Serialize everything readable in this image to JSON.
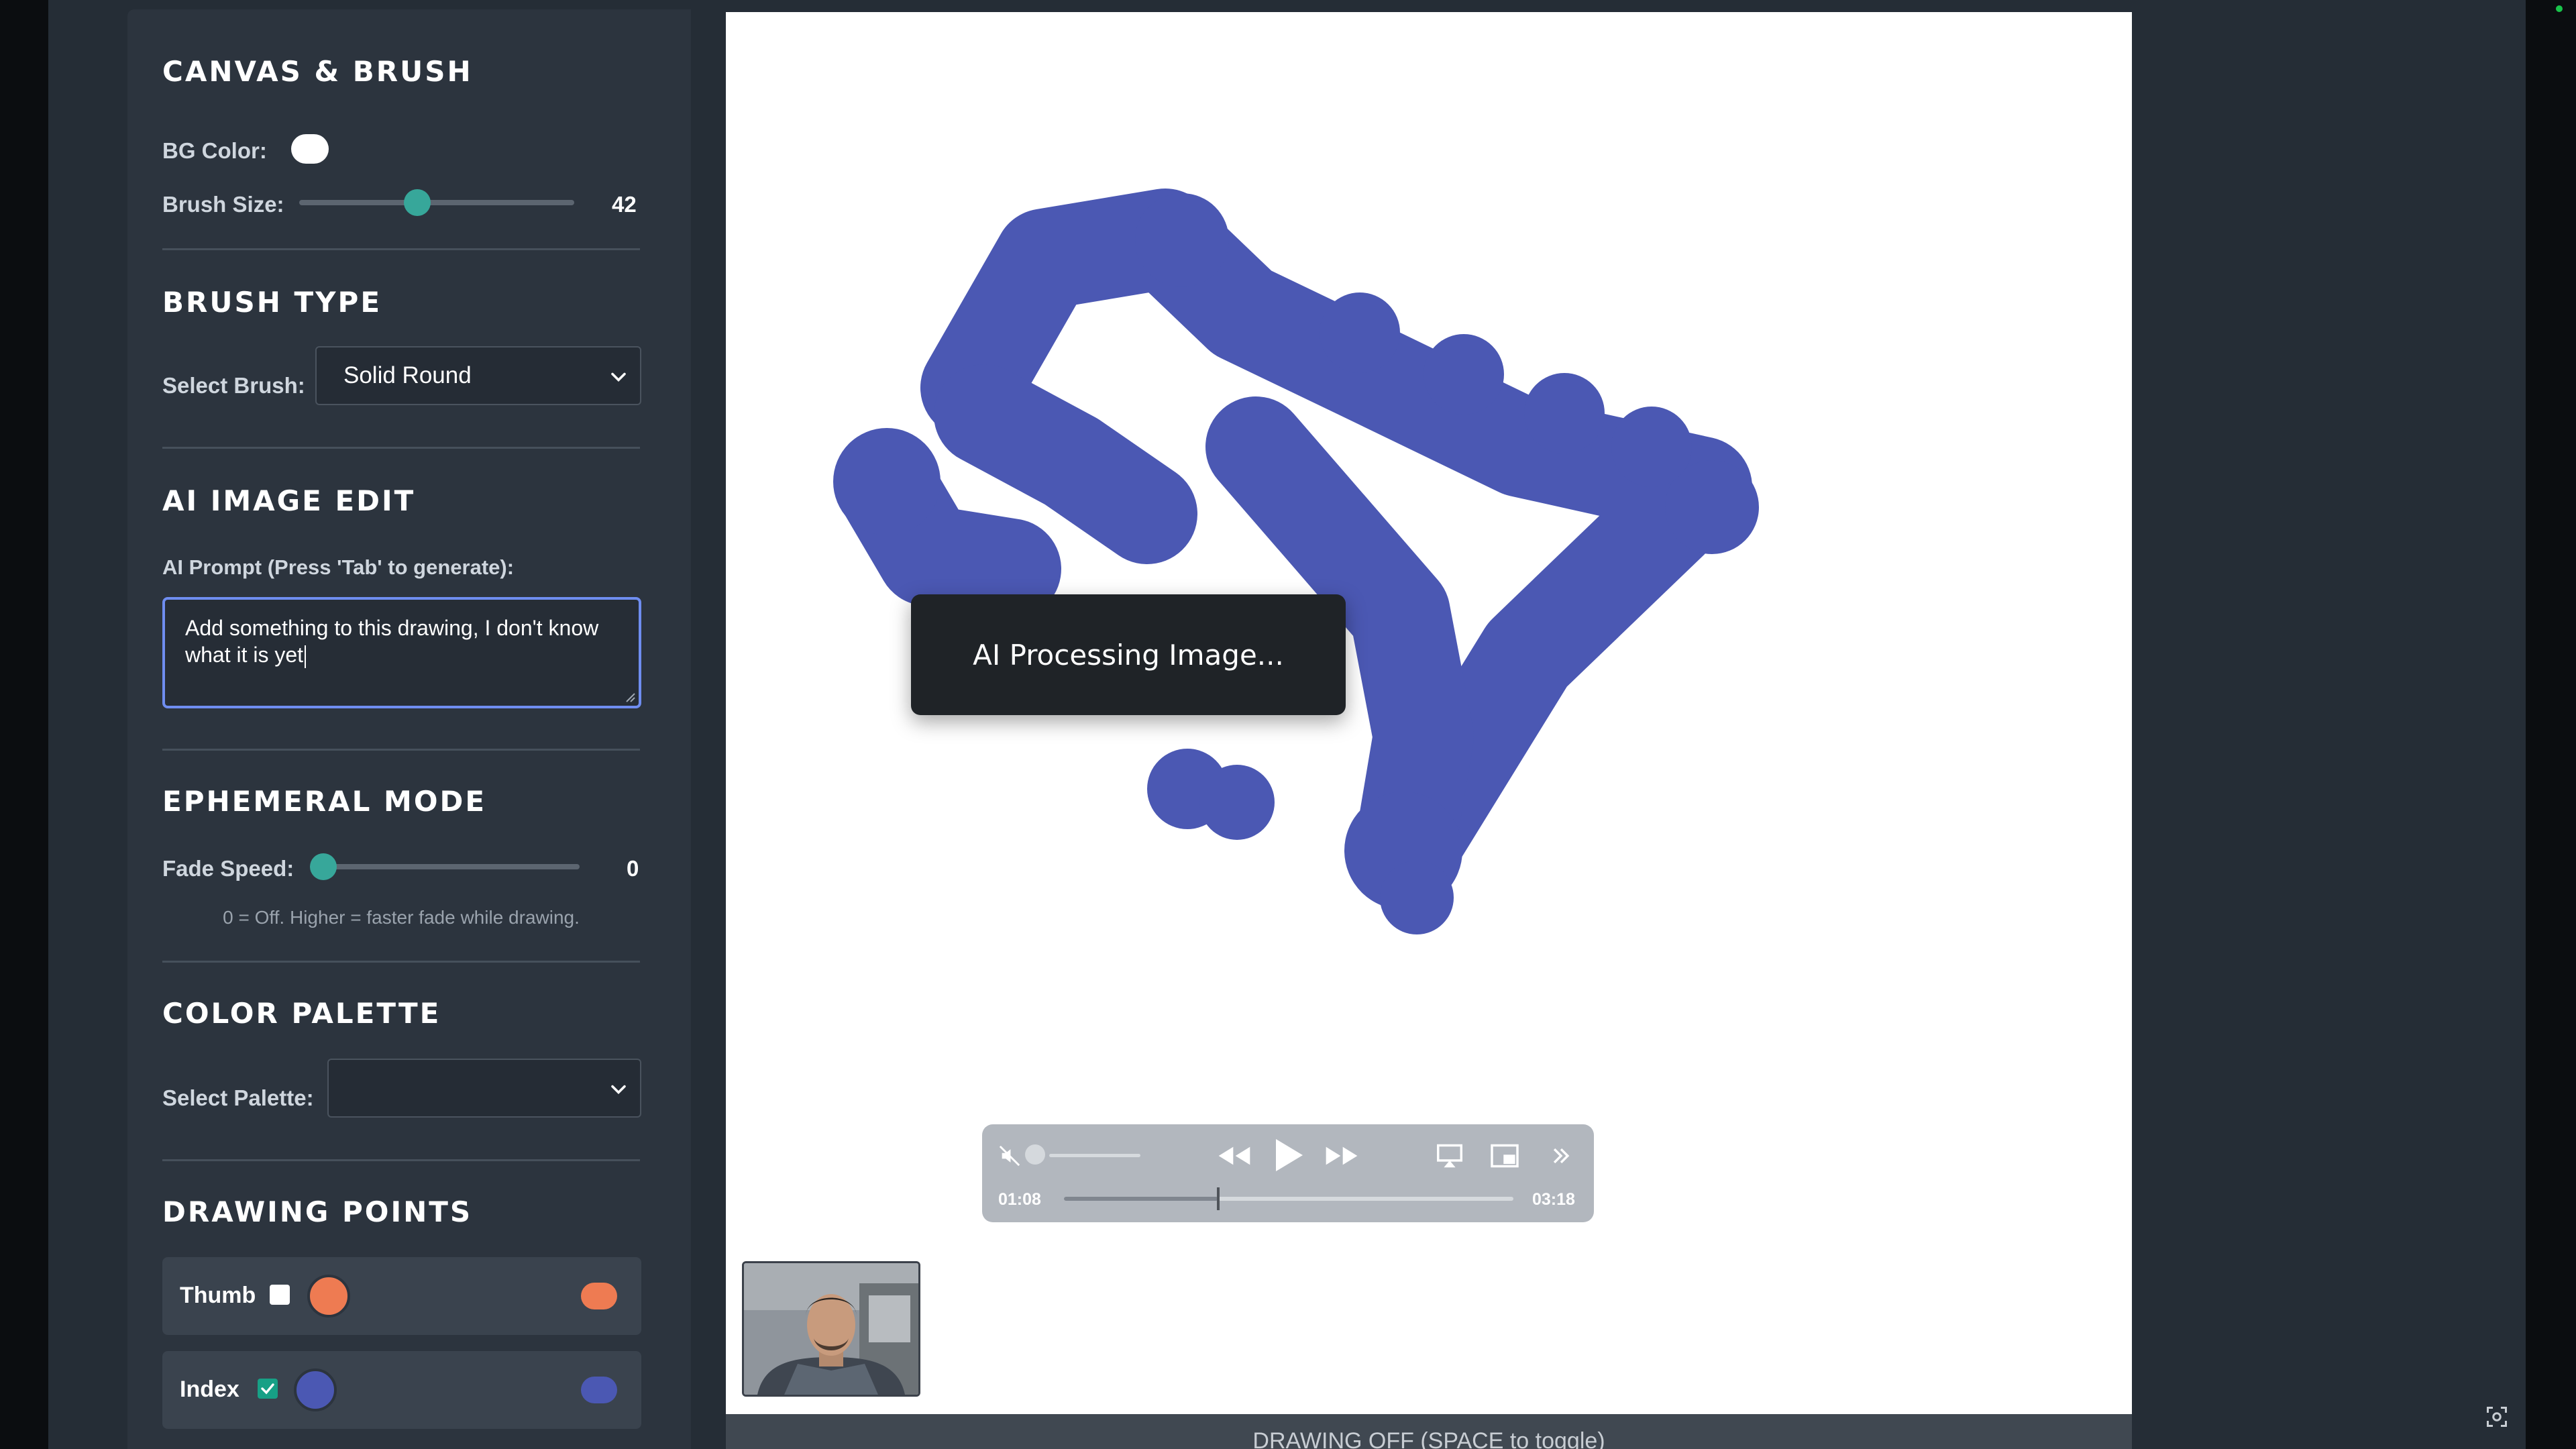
{
  "sidebar": {
    "canvas_brush": {
      "title": "CANVAS & BRUSH",
      "bg_color_label": "BG Color:",
      "bg_color": "#ffffff",
      "brush_size_label": "Brush Size:",
      "brush_size_value": "42"
    },
    "brush_type": {
      "title": "BRUSH TYPE",
      "select_label": "Select Brush:",
      "selected": "Solid Round"
    },
    "ai_edit": {
      "title": "AI IMAGE EDIT",
      "prompt_label": "AI Prompt (Press 'Tab' to generate):",
      "prompt_value": "Add something to this drawing, I don't know what it is yet"
    },
    "ephemeral": {
      "title": "EPHEMERAL MODE",
      "fade_label": "Fade Speed:",
      "fade_value": "0",
      "help": "0 = Off. Higher = faster fade while drawing."
    },
    "palette": {
      "title": "COLOR PALETTE",
      "select_label": "Select Palette:",
      "selected": ""
    },
    "drawing_points": {
      "title": "DRAWING POINTS",
      "items": [
        {
          "label": "Thumb",
          "checked": false,
          "color": "#ee7b52"
        },
        {
          "label": "Index",
          "checked": true,
          "color": "#4b58b3"
        }
      ]
    }
  },
  "canvas": {
    "stroke_color": "#4b58b3",
    "processing_text": "AI Processing Image..."
  },
  "player": {
    "current_time": "01:08",
    "duration": "03:18",
    "progress_fraction": 0.343,
    "volume_muted": true
  },
  "status_bar": {
    "text": "DRAWING OFF (SPACE to toggle)"
  }
}
